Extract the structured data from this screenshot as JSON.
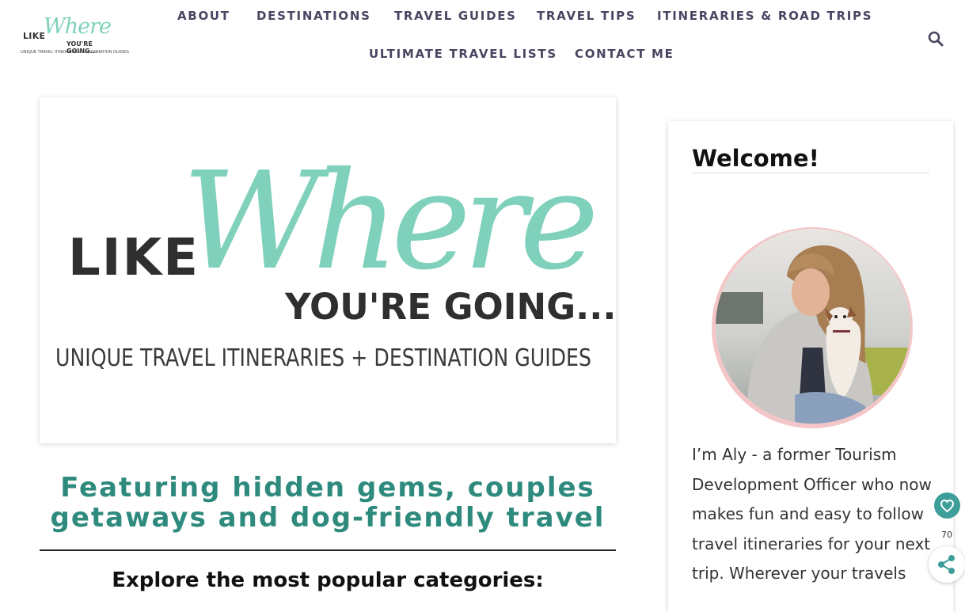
{
  "header": {
    "logo": {
      "like": "LIKE",
      "where": "Where",
      "going": "YOU'RE GOING...",
      "tagline": "UNIQUE TRAVEL ITINERARIES + DESTINATION GUIDES"
    },
    "nav": [
      {
        "label": "ABOUT"
      },
      {
        "label": "DESTINATIONS"
      },
      {
        "label": "TRAVEL GUIDES"
      },
      {
        "label": "TRAVEL TIPS"
      },
      {
        "label": "ITINERARIES & ROAD TRIPS"
      },
      {
        "label": "ULTIMATE TRAVEL LISTS"
      },
      {
        "label": "CONTACT ME"
      }
    ],
    "search_icon": "search-icon"
  },
  "hero": {
    "like": "LIKE",
    "where": "Where",
    "going": "YOU'RE GOING...",
    "tagline": "UNIQUE TRAVEL ITINERARIES + DESTINATION GUIDES"
  },
  "main": {
    "headline": "Featuring hidden gems, couples getaways and dog-friendly travel",
    "explore_heading": "Explore the most popular categories:"
  },
  "sidebar": {
    "title": "Welcome!",
    "bio": "I’m Aly - a former Tourism Development Officer who now makes fun and easy to follow travel itineraries for your next trip. Wherever your travels"
  },
  "share": {
    "count": "70",
    "heart_icon": "heart-icon",
    "share_icon": "share-icon"
  },
  "colors": {
    "accent_teal": "#7fd1bb",
    "headline_teal": "#2e8a7d",
    "nav_text": "#4a4561",
    "avatar_ring": "#f4c6c8",
    "share_button": "#3e9e9a"
  }
}
